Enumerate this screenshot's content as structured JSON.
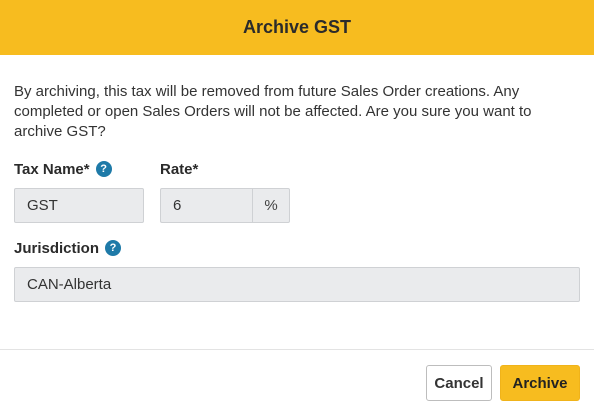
{
  "dialog": {
    "title": "Archive GST",
    "message": "By archiving, this tax will be removed from future Sales Order creations. Any completed or open Sales Orders will not be affected. Are you sure you want to archive GST?"
  },
  "form": {
    "tax_name_label": "Tax Name*",
    "tax_name_value": "GST",
    "rate_label": "Rate*",
    "rate_value": "6",
    "rate_suffix": "%",
    "jurisdiction_label": "Jurisdiction",
    "jurisdiction_value": "CAN-Alberta",
    "help_glyph": "?"
  },
  "footer": {
    "cancel_label": "Cancel",
    "archive_label": "Archive"
  },
  "colors": {
    "accent": "#f7bc1f",
    "help_icon": "#1e7aa8",
    "input_bg": "#eaebed"
  }
}
